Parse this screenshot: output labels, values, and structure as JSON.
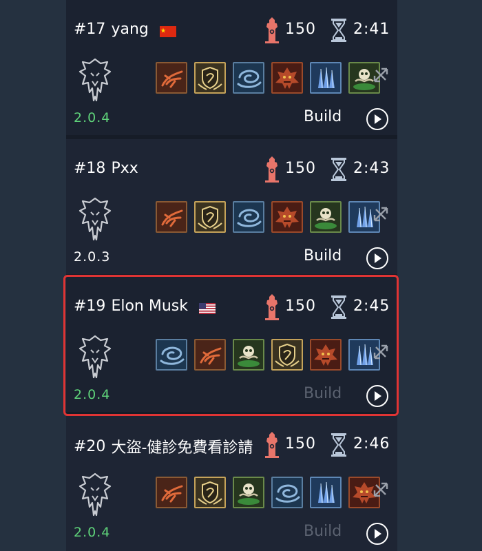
{
  "entries": [
    {
      "rank": "#17",
      "name": "yang",
      "flag": "china-flag",
      "floor": "150",
      "time": "2:41",
      "version": "2.0.4",
      "version_color": "#5fd37a",
      "build_label": "Build",
      "build_color": "#ffffff",
      "glyphs": [
        "ranger-glyph-icon",
        "exploit-glyph-icon",
        "vortex-glyph-icon",
        "wrath-glyph-icon",
        "ice-spike-glyph-icon",
        "poison-glyph-icon"
      ]
    },
    {
      "rank": "#18",
      "name": "Pxx",
      "flag": "",
      "floor": "150",
      "time": "2:43",
      "version": "2.0.3",
      "version_color": "#ffffff",
      "build_label": "Build",
      "build_color": "#ffffff",
      "glyphs": [
        "ranger-glyph-icon",
        "exploit-glyph-icon",
        "vortex-glyph-icon",
        "wrath-glyph-icon",
        "poison-glyph-icon",
        "ice-spike-glyph-icon"
      ]
    },
    {
      "rank": "#19",
      "name": "Elon Musk",
      "flag": "usa-flag",
      "floor": "150",
      "time": "2:45",
      "version": "2.0.4",
      "version_color": "#5fd37a",
      "build_label": "Build",
      "build_color": "#5b6270",
      "glyphs": [
        "vortex-glyph-icon",
        "ranger-glyph-icon",
        "poison-glyph-icon",
        "exploit-glyph-icon",
        "wrath-glyph-icon",
        "ice-spike-glyph-icon"
      ]
    },
    {
      "rank": "#20",
      "name": "大盜-健診免費看診請",
      "flag": "",
      "floor": "150",
      "time": "2:46",
      "version": "2.0.4",
      "version_color": "#5fd37a",
      "build_label": "Build",
      "build_color": "#5b6270",
      "glyphs": [
        "ranger-glyph-icon",
        "exploit-glyph-icon",
        "poison-glyph-icon",
        "vortex-glyph-icon",
        "ice-spike-glyph-icon",
        "wrath-glyph-icon"
      ]
    }
  ],
  "colors": {
    "highlight": "#e03434",
    "tower": "#e8756a",
    "hourglass": "#b9c7d9"
  }
}
